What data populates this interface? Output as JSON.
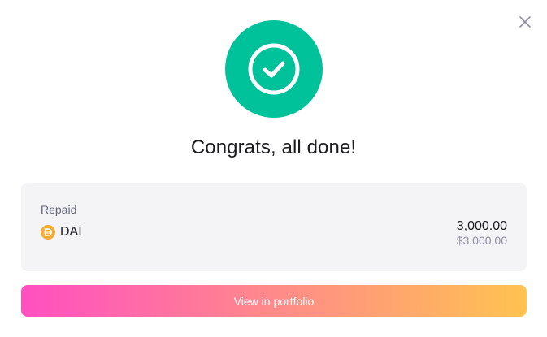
{
  "modal": {
    "title": "Congrats, all done!",
    "close_icon": "close-icon",
    "success_icon": "check-circle-icon"
  },
  "summary": {
    "label": "Repaid",
    "asset_symbol": "DAI",
    "asset_icon": "dai-token-icon",
    "amount": "3,000.00",
    "amount_usd": "$3,000.00"
  },
  "actions": {
    "view_portfolio_label": "View in portfolio"
  },
  "colors": {
    "success": "#00c29a",
    "dai_token": "#f5ac37",
    "button_gradient_start": "#ff4fc1",
    "button_gradient_end": "#ffc350"
  }
}
